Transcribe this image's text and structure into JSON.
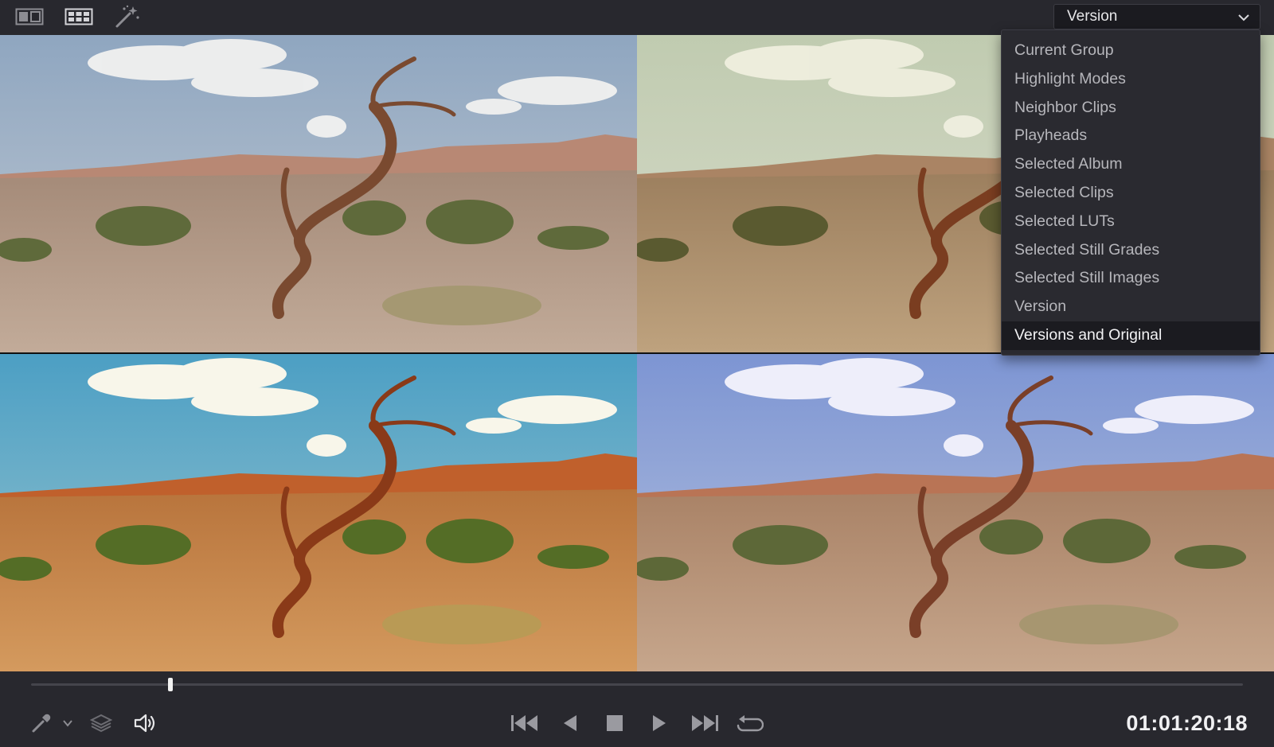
{
  "toolbar": {
    "icons": [
      "split-screen-icon",
      "grid-view-icon",
      "magic-wand-icon"
    ],
    "version_select": {
      "value": "Version",
      "options": [
        "Current Group",
        "Highlight Modes",
        "Neighbor Clips",
        "Playheads",
        "Selected Album",
        "Selected Clips",
        "Selected LUTs",
        "Selected Still Grades",
        "Selected Still Images",
        "Version",
        "Versions and Original"
      ],
      "highlighted_option": "Versions and Original"
    }
  },
  "viewer": {
    "tiles": [
      {
        "grade": "neutral",
        "sky": "#9fb3c9",
        "ground": "#b79f8e"
      },
      {
        "grade": "faded-warm",
        "sky": "#c9d0b4",
        "ground": "#b59a76"
      },
      {
        "grade": "saturated-warm",
        "sky": "#5ea8c7",
        "ground": "#c8854a"
      },
      {
        "grade": "cool-blue",
        "sky": "#8ea4d8",
        "ground": "#b7937a"
      }
    ]
  },
  "transport": {
    "playhead_fraction": 0.115,
    "timecode": "01:01:20:18",
    "left_icons": [
      "eyedropper-icon",
      "layers-icon",
      "speaker-icon"
    ],
    "controls": [
      "skip-to-start-icon",
      "step-back-icon",
      "stop-icon",
      "play-icon",
      "skip-to-end-icon",
      "loop-icon"
    ]
  },
  "colors": {
    "toolbar_bg": "#28282e",
    "dropdown_bg": "#2a2a30",
    "highlight_bg": "#1b1b20",
    "text": "#b6b6bb"
  }
}
